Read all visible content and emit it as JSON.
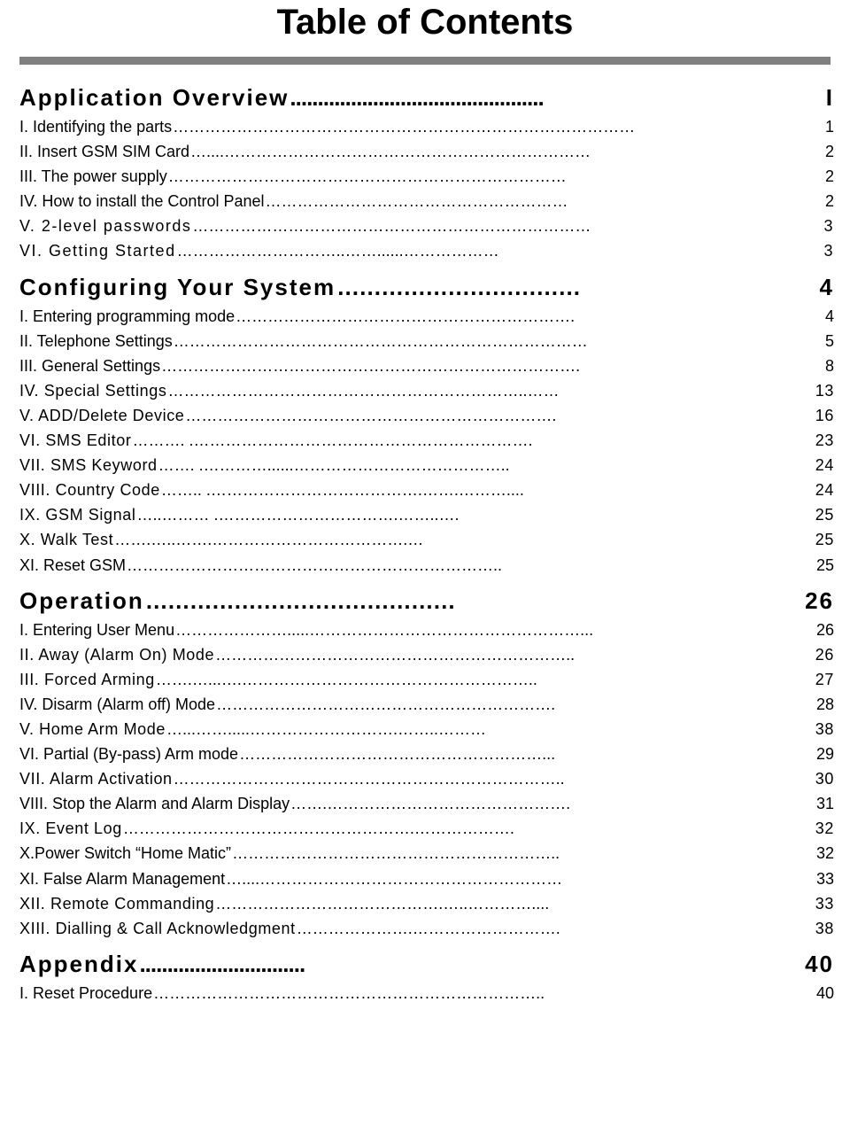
{
  "document": {
    "title": "Table of Contents"
  },
  "sections": [
    {
      "heading": "Application Overview",
      "heading_leader": "..............................................",
      "heading_page": "I",
      "entries": [
        {
          "label": "I. Identifying the parts",
          "leader": "……………………………………………………………………………",
          "page": "1"
        },
        {
          "label": "II. Insert GSM SIM Card",
          "leader": "…....……………………………………………………………",
          "page": "2"
        },
        {
          "label": "III. The power supply",
          "leader": "…………………………………………………………………",
          "page": "2"
        },
        {
          "label": "IV. How to install the Control Panel",
          "leader": "…………………………………………………",
          "page": "2"
        },
        {
          "label": "V.  2-level  passwords",
          "leader": "…………………………………………………………………",
          "page": "3"
        },
        {
          "label": "VI.  Getting Started",
          "leader": "…………………………..……......………………",
          "page": "3"
        }
      ]
    },
    {
      "heading": "Configuring Your System",
      "heading_leader": "……………………………",
      "heading_page": "4",
      "entries": [
        {
          "label": "I. Entering programming mode",
          "leader": "……………………………………………………….",
          "page": "4"
        },
        {
          "label": "II. Telephone Settings",
          "leader": "……………………………………………………………………",
          "page": "5"
        },
        {
          "label": "III. General Settings",
          "leader": "…………………………………………………………………….",
          "page": "8"
        },
        {
          "label": "IV.  Special  Settings",
          "leader": "…………………………………………………………..……",
          "page": "13"
        },
        {
          "label": "V.  ADD/Delete  Device",
          "leader": "…………………………………………………………….",
          "page": "16"
        },
        {
          "label": "VI.  SMS  Editor",
          "leader": "……….    .……………………………………………………….",
          "page": "23"
        },
        {
          "label": "VII.  SMS  Keyword",
          "leader": "…….     .…………......…………………………………..",
          "page": "24"
        },
        {
          "label": "VIII.  Country  Code",
          "leader": "……..    .………………………………….…….………....",
          "page": "24"
        },
        {
          "label": "IX.  GSM  Signal",
          "leader": "…..………   .…………………………….……..….",
          "page": "25"
        },
        {
          "label": "X.  Walk  Test",
          "leader": "…….…..…….……………………………….…",
          "page": "25"
        },
        {
          "label": "XI. Reset GSM",
          "leader": "……………………………………………………………..",
          "page": "25"
        }
      ]
    },
    {
      "heading": "Operation",
      "heading_leader": "……………………………………",
      "heading_page": "26",
      "entries": [
        {
          "label": "I. Entering User Menu",
          "leader": "………………….....……………………………………………...",
          "page": "26"
        },
        {
          "label": "II.  Away  (Alarm  On)  Mode",
          "leader": "…………………………………………………………..",
          "page": "26"
        },
        {
          "label": "III.  Forced  Arming",
          "leader": "…….…...….………………………………………………..",
          "page": "27"
        },
        {
          "label": "IV. Disarm (Alarm off) Mode",
          "leader": "……………………………………………………….",
          "page": "28"
        },
        {
          "label": "V.  Home  Arm  Mode",
          "leader": "…...…….....……………………….……..………",
          "page": "38"
        },
        {
          "label": "VI. Partial (By-pass) Arm mode",
          "leader": "…………………………………………………...",
          "page": "29"
        },
        {
          "label": "VII.  Alarm  Activation",
          "leader": "………………………………………………………………..",
          "page": "30"
        },
        {
          "label": "VIII. Stop the Alarm and Alarm Display",
          "leader": "…….……………………………………….",
          "page": "31"
        },
        {
          "label": "IX.  Event  Log",
          "leader": "……………………………………………….……………….",
          "page": "32"
        },
        {
          "label": "X.Power Switch “Home Matic”",
          "leader": "……………………………………………………..",
          "page": "32"
        },
        {
          "label": "XI. False Alarm Management",
          "leader": "…....…………………………………………………",
          "page": "33"
        },
        {
          "label": "XII.  Remote  Commanding",
          "leader": "…………………………………….…..…………....",
          "page": "33"
        },
        {
          "label": "XIII.  Dialling  &  Call  Acknowledgment",
          "leader": "………………….……………………….",
          "page": "38"
        }
      ]
    },
    {
      "heading": "Appendix",
      "heading_leader": "..............................",
      "heading_page": "40",
      "entries": [
        {
          "label": "I. Reset Procedure",
          "leader": "………………………………………………………………..",
          "page": "40"
        }
      ]
    }
  ]
}
